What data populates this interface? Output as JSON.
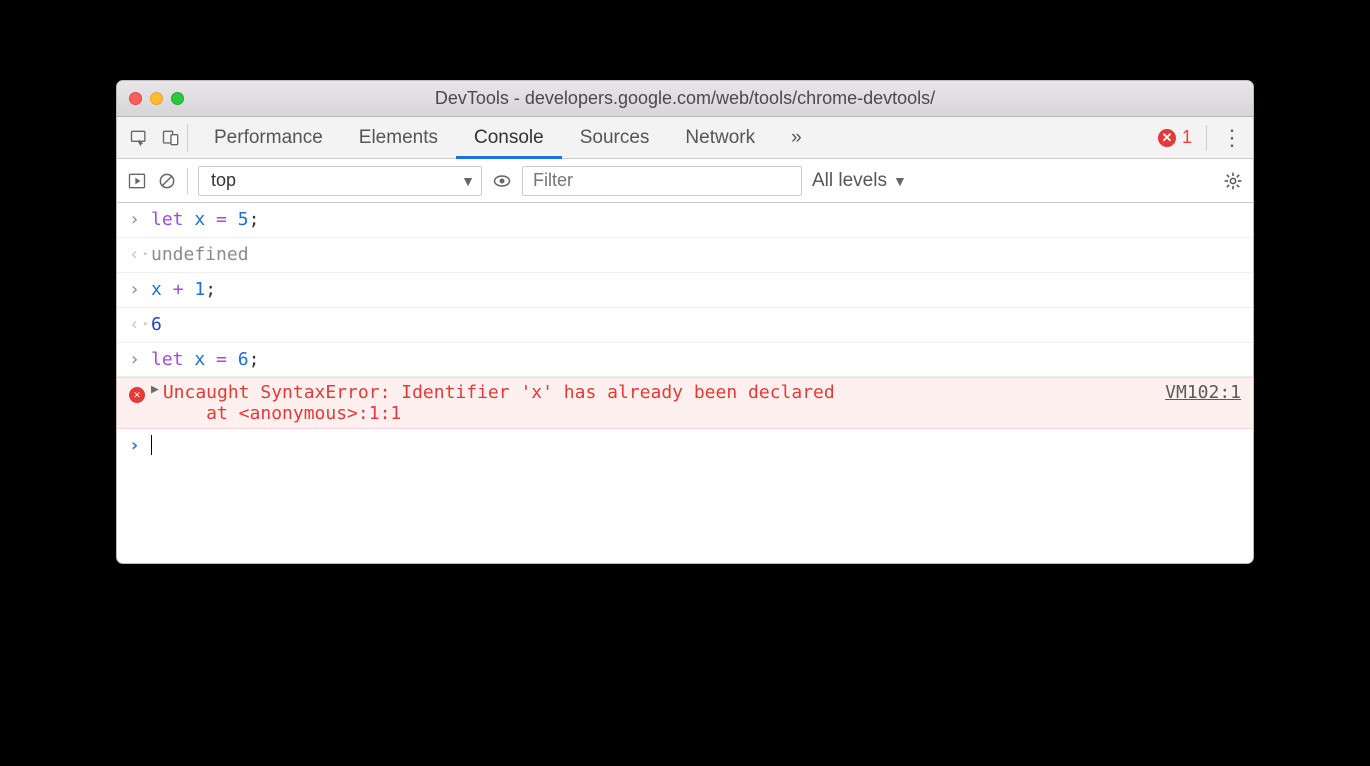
{
  "window": {
    "title": "DevTools - developers.google.com/web/tools/chrome-devtools/"
  },
  "tabs": {
    "items": [
      "Performance",
      "Elements",
      "Console",
      "Sources",
      "Network"
    ],
    "active": "Console",
    "overflow": "»",
    "error_count": "1"
  },
  "toolbar": {
    "context": "top",
    "filter_placeholder": "Filter",
    "levels": "All levels"
  },
  "console": {
    "lines": [
      {
        "type": "input",
        "tokens": [
          [
            "let",
            "let "
          ],
          [
            "var",
            "x"
          ],
          [
            "plain",
            " "
          ],
          [
            "op",
            "="
          ],
          [
            "plain",
            " "
          ],
          [
            "num",
            "5"
          ],
          [
            "semi",
            ";"
          ]
        ]
      },
      {
        "type": "output",
        "kind": "undef",
        "text": "undefined"
      },
      {
        "type": "input",
        "tokens": [
          [
            "var",
            "x"
          ],
          [
            "plain",
            " "
          ],
          [
            "op",
            "+"
          ],
          [
            "plain",
            " "
          ],
          [
            "num",
            "1"
          ],
          [
            "semi",
            ";"
          ]
        ]
      },
      {
        "type": "output",
        "kind": "num",
        "text": "6"
      },
      {
        "type": "input",
        "tokens": [
          [
            "let",
            "let "
          ],
          [
            "var",
            "x"
          ],
          [
            "plain",
            " "
          ],
          [
            "op",
            "="
          ],
          [
            "plain",
            " "
          ],
          [
            "num",
            "6"
          ],
          [
            "semi",
            ";"
          ]
        ]
      }
    ],
    "error": {
      "message": "Uncaught SyntaxError: Identifier 'x' has already been declared\n    at <anonymous>:1:1",
      "source": "VM102:1"
    }
  }
}
